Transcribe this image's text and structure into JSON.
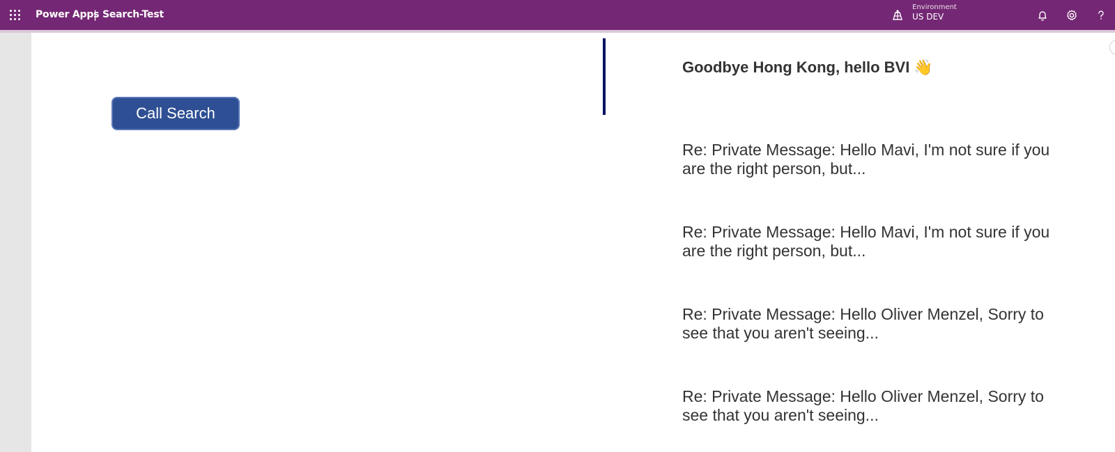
{
  "header": {
    "app_name": "Power Apps",
    "separator": "|",
    "app_title": "Search-Test",
    "environment_label": "Environment",
    "environment_value": "US DEV",
    "bg_color": "#742774"
  },
  "icons": {
    "waffle": "waffle-icon",
    "environment": "environment-icon",
    "notifications": "bell-icon",
    "settings": "gear-icon",
    "help": "help-icon"
  },
  "canvas": {
    "button_label": "Call Search",
    "button_color": "#2e4f93",
    "accent_bar_color": "#0a1564"
  },
  "gallery": {
    "items": [
      {
        "title": "Goodbye Hong Kong, hello BVI 👋"
      },
      {
        "title": "Re: Private Message: Hello Mavi, I'm not sure if you are the right person, but..."
      },
      {
        "title": "Re: Private Message: Hello Mavi, I'm not sure if you are the right person, but..."
      },
      {
        "title": "Re: Private Message: Hello Oliver Menzel, Sorry to see that you aren't seeing..."
      },
      {
        "title": "Re: Private Message: Hello Oliver Menzel, Sorry to see that you aren't seeing..."
      }
    ]
  }
}
